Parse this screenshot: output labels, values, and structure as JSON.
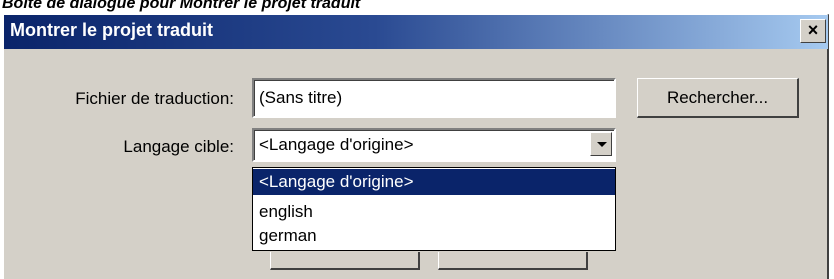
{
  "caption": "Boîte de dialogue pour Montrer le  projet traduit",
  "dialog": {
    "title": "Montrer le projet traduit",
    "close_glyph": "×"
  },
  "form": {
    "file_label": "Fichier de traduction:",
    "file_value": "(Sans titre)",
    "browse_label": "Rechercher...",
    "language_label": "Langage cible:",
    "language_value": "<Langage d'origine>",
    "language_options": [
      "<Langage d'origine>",
      "english",
      "german"
    ],
    "selected_option_index": 0
  },
  "icons": {
    "close": "close-icon",
    "dropdown": "chevron-down-icon"
  },
  "colors": {
    "titlebar_start": "#0a246a",
    "titlebar_end": "#a6caf0",
    "dialog_face": "#d4d0c8",
    "selection": "#0a246a"
  }
}
